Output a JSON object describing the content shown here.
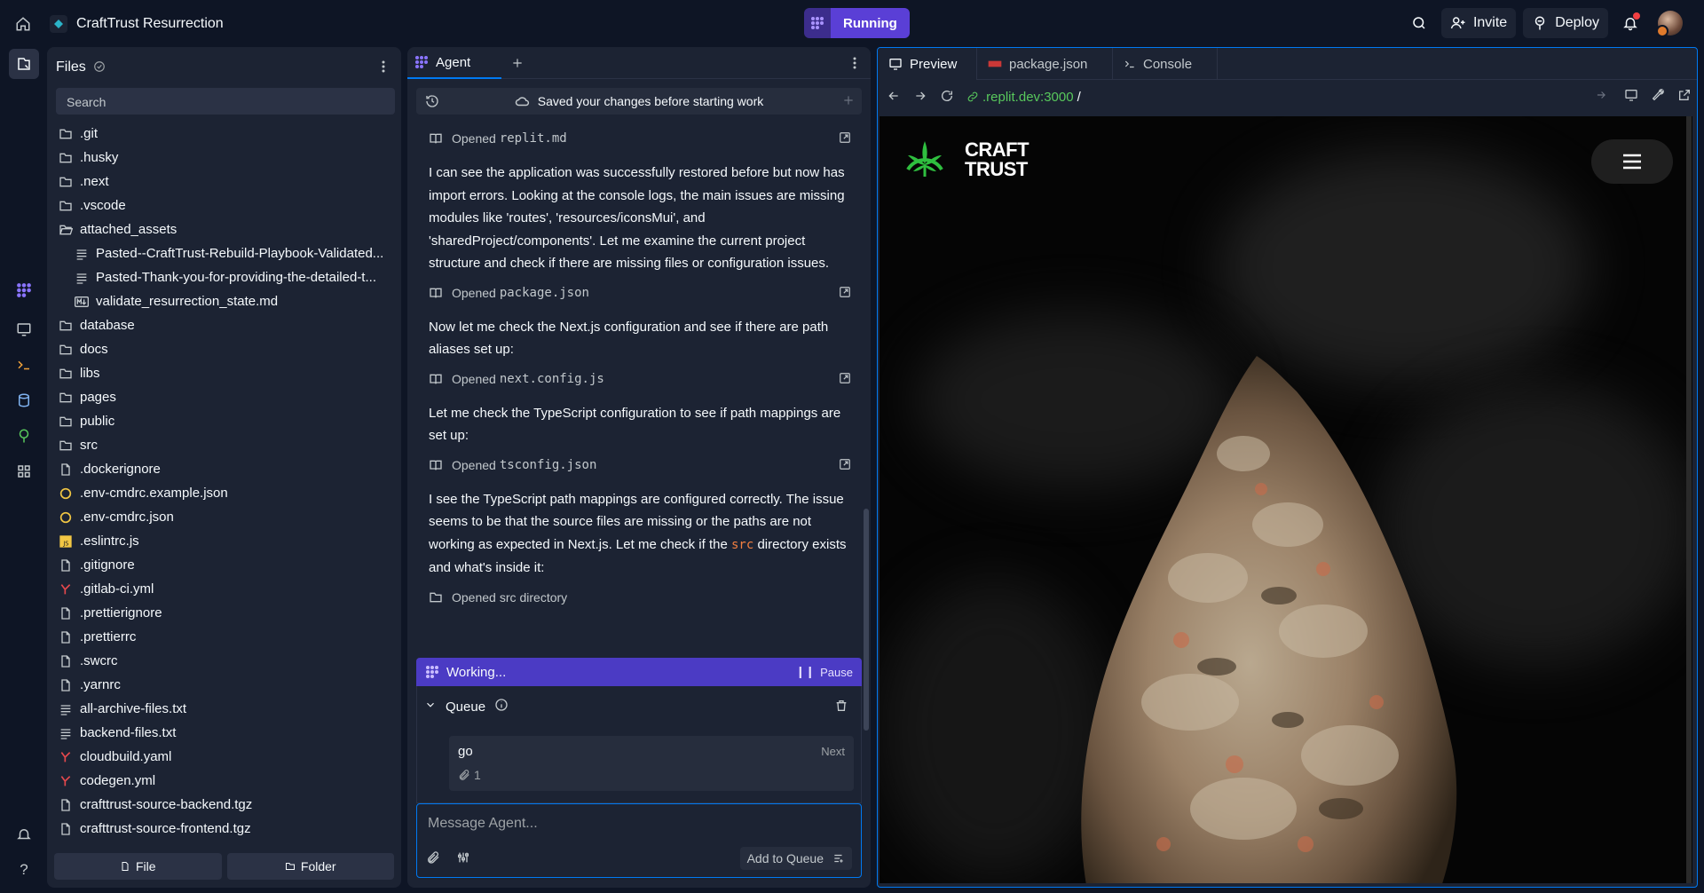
{
  "app": {
    "repl_name": "CraftTrust Resurrection",
    "run_label": "Running",
    "invite_label": "Invite",
    "deploy_label": "Deploy"
  },
  "files": {
    "title": "Files",
    "search_placeholder": "Search",
    "new_file_label": "File",
    "new_folder_label": "Folder",
    "items": [
      {
        "name": ".git",
        "icon": "folder-icon",
        "nested": false
      },
      {
        "name": ".husky",
        "icon": "folder-icon",
        "nested": false
      },
      {
        "name": ".next",
        "icon": "folder-icon",
        "nested": false
      },
      {
        "name": ".vscode",
        "icon": "folder-icon",
        "nested": false
      },
      {
        "name": "attached_assets",
        "icon": "folder-open-icon",
        "nested": false
      },
      {
        "name": "Pasted--CraftTrust-Rebuild-Playbook-Validated...",
        "icon": "text-file-icon",
        "nested": true
      },
      {
        "name": "Pasted-Thank-you-for-providing-the-detailed-t...",
        "icon": "text-file-icon",
        "nested": true
      },
      {
        "name": "validate_resurrection_state.md",
        "icon": "markdown-file-icon",
        "nested": true
      },
      {
        "name": "database",
        "icon": "folder-icon",
        "nested": false
      },
      {
        "name": "docs",
        "icon": "folder-icon",
        "nested": false
      },
      {
        "name": "libs",
        "icon": "folder-icon",
        "nested": false
      },
      {
        "name": "pages",
        "icon": "folder-icon",
        "nested": false
      },
      {
        "name": "public",
        "icon": "folder-icon",
        "nested": false
      },
      {
        "name": "src",
        "icon": "folder-icon",
        "nested": false
      },
      {
        "name": ".dockerignore",
        "icon": "file-icon",
        "nested": false
      },
      {
        "name": ".env-cmdrc.example.json",
        "icon": "json-file-icon",
        "nested": false
      },
      {
        "name": ".env-cmdrc.json",
        "icon": "json-file-icon",
        "nested": false
      },
      {
        "name": ".eslintrc.js",
        "icon": "js-file-icon",
        "nested": false
      },
      {
        "name": ".gitignore",
        "icon": "file-icon",
        "nested": false
      },
      {
        "name": ".gitlab-ci.yml",
        "icon": "yaml-file-icon",
        "nested": false
      },
      {
        "name": ".prettierignore",
        "icon": "file-icon",
        "nested": false
      },
      {
        "name": ".prettierrc",
        "icon": "file-icon",
        "nested": false
      },
      {
        "name": ".swcrc",
        "icon": "file-icon",
        "nested": false
      },
      {
        "name": ".yarnrc",
        "icon": "file-icon",
        "nested": false
      },
      {
        "name": "all-archive-files.txt",
        "icon": "text-file-icon",
        "nested": false
      },
      {
        "name": "backend-files.txt",
        "icon": "text-file-icon",
        "nested": false
      },
      {
        "name": "cloudbuild.yaml",
        "icon": "yaml-file-icon",
        "nested": false
      },
      {
        "name": "codegen.yml",
        "icon": "yaml-file-icon",
        "nested": false
      },
      {
        "name": "crafttrust-source-backend.tgz",
        "icon": "file-icon",
        "nested": false
      },
      {
        "name": "crafttrust-source-frontend.tgz",
        "icon": "file-icon",
        "nested": false
      }
    ]
  },
  "agent": {
    "tab_label": "Agent",
    "saved_banner": "Saved your changes before starting work",
    "opened_label": "Opened",
    "timeline": [
      {
        "kind": "action",
        "icon": "book-icon",
        "file": "replit.md",
        "suffix": ""
      },
      {
        "kind": "message",
        "text": "I can see the application was successfully restored before but now has import errors. Looking at the console logs, the main issues are missing modules like 'routes', 'resources/iconsMui', and 'sharedProject/components'. Let me examine the current project structure and check if there are missing files or configuration issues."
      },
      {
        "kind": "action",
        "icon": "book-icon",
        "file": "package.json",
        "suffix": ""
      },
      {
        "kind": "message",
        "text": "Now let me check the Next.js configuration and see if there are path aliases set up:"
      },
      {
        "kind": "action",
        "icon": "book-icon",
        "file": "next.config.js",
        "suffix": ""
      },
      {
        "kind": "message",
        "text": "Let me check the TypeScript configuration to see if path mappings are set up:"
      },
      {
        "kind": "action",
        "icon": "book-icon",
        "file": "tsconfig.json",
        "suffix": ""
      },
      {
        "kind": "message_code",
        "before": "I see the TypeScript path mappings are configured correctly. The issue seems to be that the source files are missing or the paths are not working as expected in Next.js. Let me check if the ",
        "code": "src",
        "after": " directory exists and what's inside it:"
      },
      {
        "kind": "action_folder",
        "icon": "folder-icon",
        "file": "src",
        "suffix": "directory"
      }
    ],
    "working_label": "Working...",
    "pause_label": "Pause",
    "queue_label": "Queue",
    "queue_item_text": "go",
    "queue_item_next": "Next",
    "queue_item_attachments": "1",
    "input_placeholder": "Message Agent...",
    "add_to_queue_label": "Add to Queue"
  },
  "preview": {
    "tabs": [
      {
        "label": "Preview",
        "icon": "monitor-icon",
        "active": true
      },
      {
        "label": "package.json",
        "icon": "json-file-icon",
        "active": false
      },
      {
        "label": "Console",
        "icon": "terminal-icon",
        "active": false
      }
    ],
    "url_host": ".replit.dev:3000",
    "url_path": "/",
    "site_logo_line1": "CRAFT",
    "site_logo_line2": "TRUST",
    "logo_color": "#2fbf3f"
  },
  "colors": {
    "accent": "#0079f2",
    "run": "#5a3fd6",
    "working": "#4b3bc4",
    "code": "#f27f40"
  }
}
